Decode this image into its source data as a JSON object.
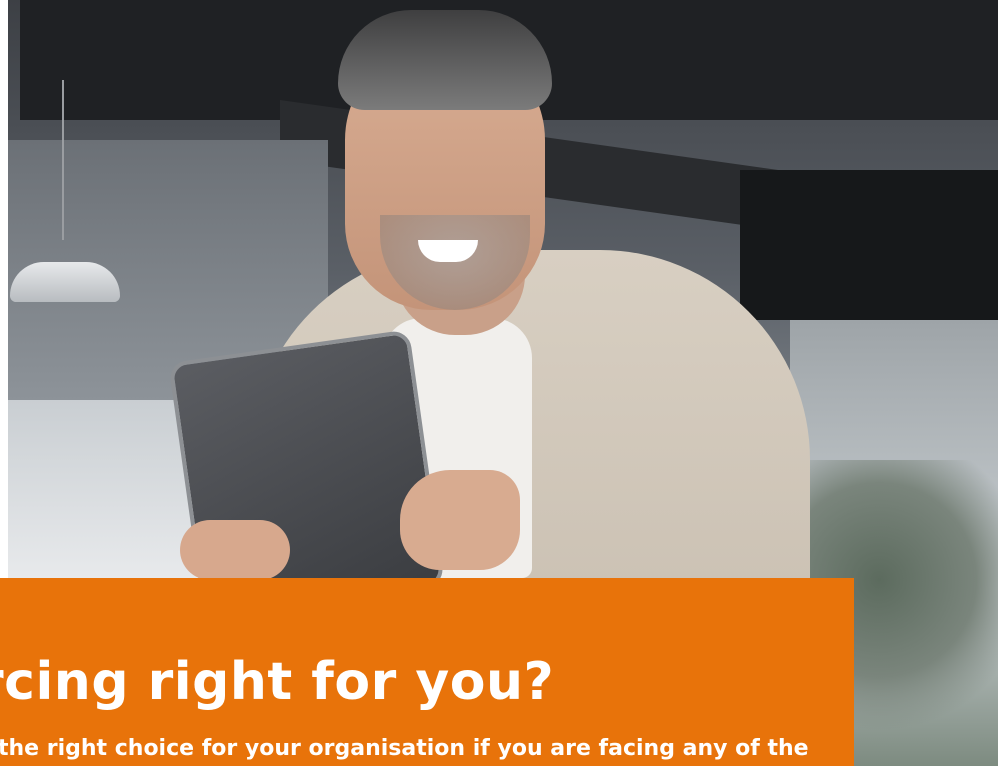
{
  "hero": {
    "headline": "rcing right for you?",
    "subline": "the right choice for your organisation if you are facing any of the"
  },
  "colors": {
    "panel": "#e8730a",
    "text": "#ffffff"
  }
}
